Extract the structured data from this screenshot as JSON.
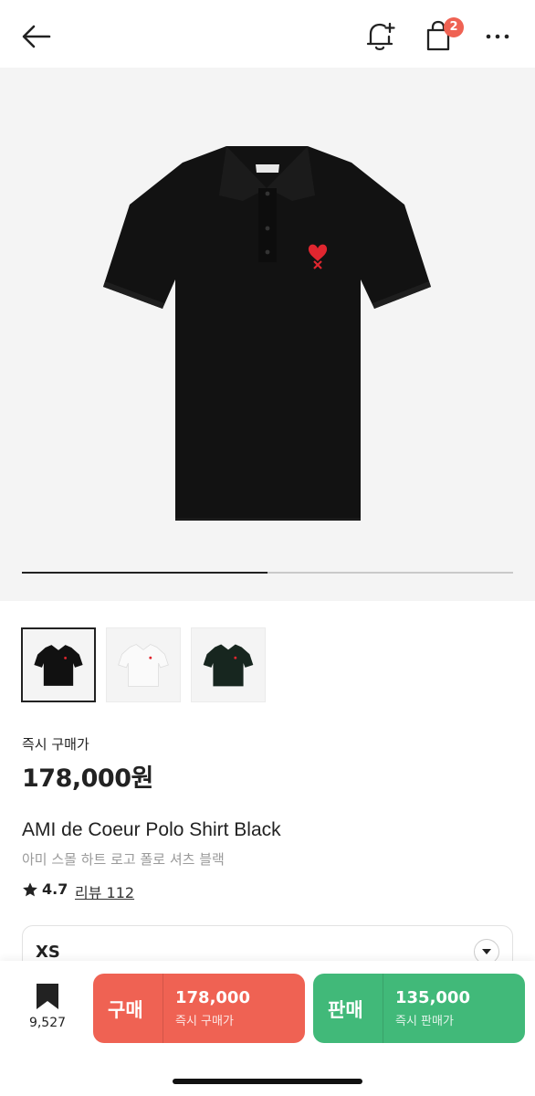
{
  "header": {
    "back_icon": "arrow-left-icon",
    "alert_icon": "bell-plus-icon",
    "bag_icon": "shopping-bag-icon",
    "bag_badge_count": "2",
    "more_icon": "more-horizontal-icon"
  },
  "gallery": {
    "image_icon": "black-polo-shirt-image",
    "progress_fraction": 0.5,
    "thumbnails": [
      {
        "name": "black-polo-thumbnail",
        "color": "#111111",
        "selected": true
      },
      {
        "name": "white-polo-thumbnail",
        "color": "#eeeeee",
        "selected": false
      },
      {
        "name": "dark-green-polo-thumbnail",
        "color": "#17261f",
        "selected": false
      }
    ]
  },
  "product": {
    "price_label": "즉시 구매가",
    "price": "178,000원",
    "name_en": "AMI de Coeur Polo Shirt Black",
    "name_ko": "아미 스몰 하트 로고 폴로 셔츠 블랙",
    "rating": "4.7",
    "review_link": "리뷰 112"
  },
  "size_selector": {
    "value": "XS",
    "dropdown_icon": "chevron-down-icon"
  },
  "bottom_bar": {
    "wish_icon": "bookmark-icon",
    "wish_count": "9,527",
    "buy": {
      "label": "구매",
      "amount": "178,000",
      "sub": "즉시 구매가"
    },
    "sell": {
      "label": "판매",
      "amount": "135,000",
      "sub": "즉시 판매가"
    }
  },
  "colors": {
    "buy": "#ef6253",
    "sell": "#41b979",
    "accent_red": "#e0262f",
    "hero_bg": "#f4f4f4"
  }
}
